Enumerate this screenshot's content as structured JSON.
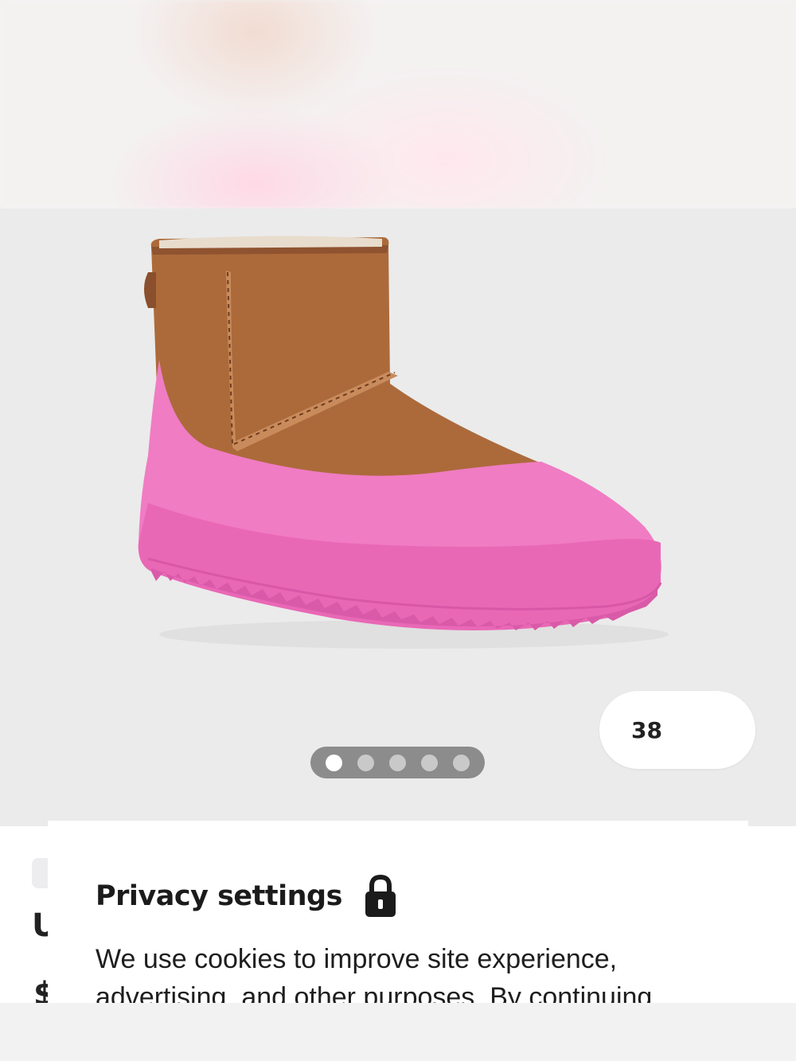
{
  "gallery": {
    "size_label": "38",
    "pagination": {
      "count": 5,
      "active_index": 0
    }
  },
  "page_background_text": {
    "heading_partial": "U",
    "price_partial": "$"
  },
  "privacy": {
    "title": "Privacy settings",
    "body_line1": "We use cookies to improve site experience,",
    "body_line2": "advertising, and other purposes. By continuing"
  },
  "icons": {
    "lock": "lock-icon"
  },
  "colors": {
    "boot_suede": "#b06a3c",
    "overshoe_pink": "#f07cc3",
    "gallery_bg": "#ebebeb",
    "pagination_bg": "#8c8c8c"
  }
}
